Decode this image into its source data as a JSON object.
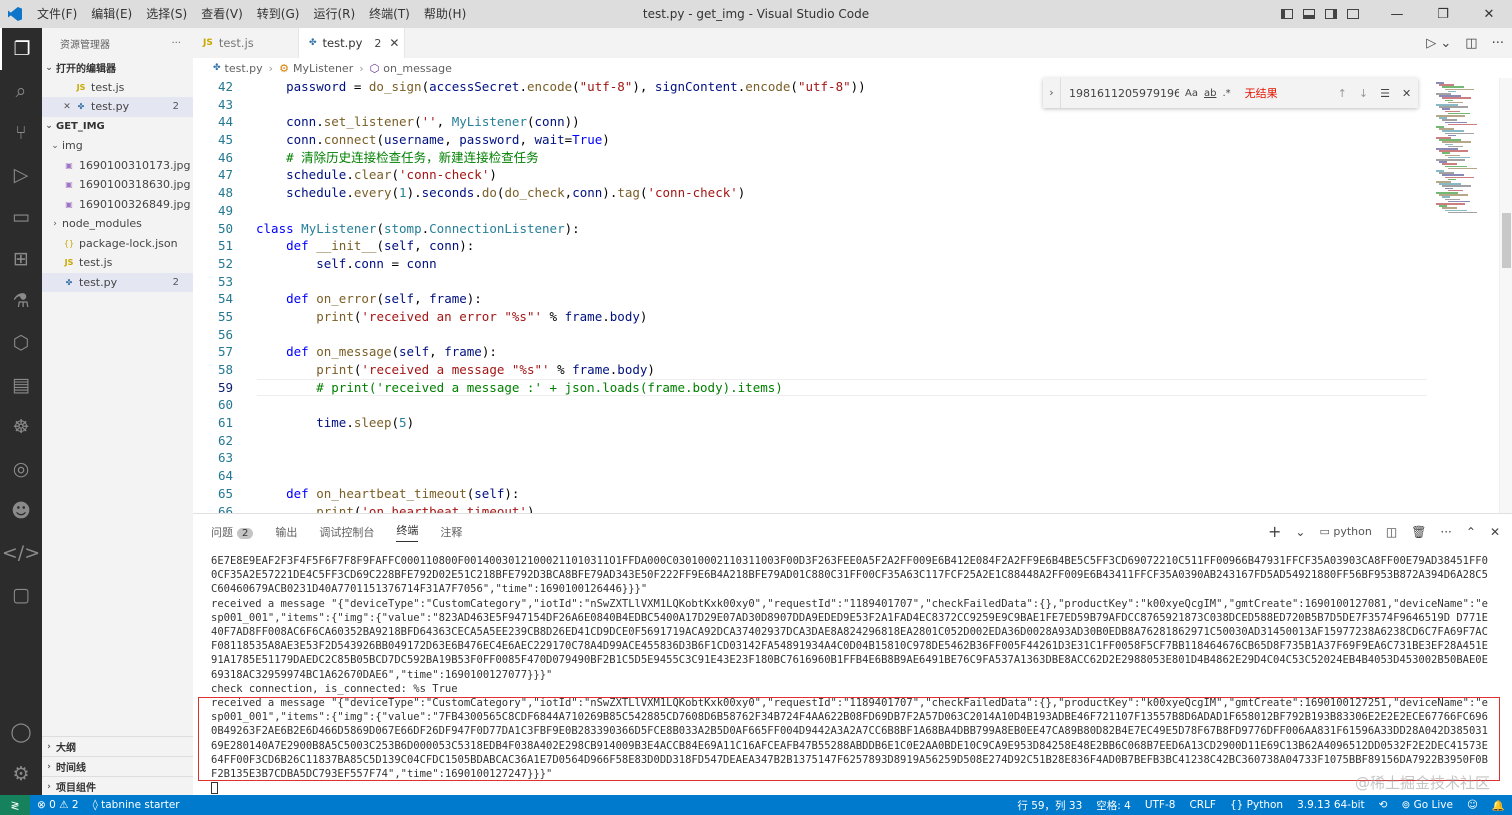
{
  "window": {
    "title": "test.py - get_img - Visual Studio Code",
    "menu": [
      "文件(F)",
      "编辑(E)",
      "选择(S)",
      "查看(V)",
      "转到(G)",
      "运行(R)",
      "终端(T)",
      "帮助(H)"
    ],
    "controls": {
      "minimize": "—",
      "restore": "❐",
      "close": "✕"
    }
  },
  "activity_bar": {
    "icons": [
      "explorer-icon",
      "search-icon",
      "source-control-icon",
      "run-debug-icon",
      "remote-explorer-icon",
      "extensions-icon",
      "testing-icon",
      "three-d-icon",
      "docker-icon",
      "octopus-icon",
      "network-icon",
      "alien-icon",
      "code-icon",
      "chat-icon"
    ],
    "bottom_icons": [
      "account-icon",
      "settings-gear-icon"
    ]
  },
  "sidebar": {
    "title": "资源管理器",
    "more": "···",
    "open_editors": {
      "header": "打开的编辑器",
      "items": [
        {
          "icon": "JS",
          "name": "test.js",
          "badge": ""
        },
        {
          "icon": "py",
          "name": "test.py",
          "badge": "2"
        }
      ]
    },
    "folder": {
      "header": "GET_IMG",
      "items": [
        {
          "type": "folder",
          "name": "img",
          "expanded": true,
          "badge": ""
        },
        {
          "type": "image",
          "name": "1690100310173.jpg",
          "badge": ""
        },
        {
          "type": "image",
          "name": "1690100318630.jpg",
          "badge": ""
        },
        {
          "type": "image",
          "name": "1690100326849.jpg",
          "badge": ""
        },
        {
          "type": "folder",
          "name": "node_modules",
          "expanded": false,
          "badge": ""
        },
        {
          "type": "json",
          "name": "package-lock.json",
          "badge": ""
        },
        {
          "type": "js",
          "name": "test.js",
          "badge": ""
        },
        {
          "type": "py",
          "name": "test.py",
          "badge": "2"
        }
      ]
    },
    "bottom_sections": [
      "大纲",
      "时间线",
      "项目组件"
    ]
  },
  "tabs": [
    {
      "icon": "JS",
      "label": "test.js",
      "badge": "",
      "active": false
    },
    {
      "icon": "py",
      "label": "test.py",
      "badge": "2",
      "active": true
    }
  ],
  "breadcrumb": {
    "file": "test.py",
    "class": "MyListener",
    "method": "on_message"
  },
  "find_widget": {
    "input": "1981611205979196.i",
    "match_case": "Aa",
    "whole_word": "ab",
    "regex": ".*",
    "result": "无结果"
  },
  "code_lines": [
    {
      "n": "42",
      "html": "    <span class=\"p\">password</span> = <span class=\"f\">do_sign</span>(<span class=\"p\">accessSecret</span>.<span class=\"f\">encode</span>(<span class=\"s\">\"utf-8\"</span>), <span class=\"p\">signContent</span>.<span class=\"f\">encode</span>(<span class=\"s\">\"utf-8\"</span>))"
    },
    {
      "n": "43",
      "html": ""
    },
    {
      "n": "44",
      "html": "    <span class=\"p\">conn</span>.<span class=\"f\">set_listener</span>(<span class=\"s\">''</span>, <span class=\"cl\">MyListener</span>(<span class=\"p\">conn</span>))"
    },
    {
      "n": "45",
      "html": "    <span class=\"p\">conn</span>.<span class=\"f\">connect</span>(<span class=\"p\">username</span>, <span class=\"p\">password</span>, <span class=\"p\">wait</span>=<span class=\"k\">True</span>)"
    },
    {
      "n": "46",
      "html": "    <span class=\"c\"># 清除历史连接检查任务，新建连接检查任务</span>"
    },
    {
      "n": "47",
      "html": "    <span class=\"p\">schedule</span>.<span class=\"f\">clear</span>(<span class=\"s\">'conn-check'</span>)"
    },
    {
      "n": "48",
      "html": "    <span class=\"p\">schedule</span>.<span class=\"f\">every</span>(<span class=\"cl\">1</span>).<span class=\"p\">seconds</span>.<span class=\"f\">do</span>(<span class=\"f\">do_check</span>,<span class=\"p\">conn</span>).<span class=\"f\">tag</span>(<span class=\"s\">'conn-check'</span>)"
    },
    {
      "n": "49",
      "html": ""
    },
    {
      "n": "50",
      "html": "<span class=\"k\">class</span> <span class=\"cl\">MyListener</span>(<span class=\"cl\">stomp</span>.<span class=\"cl\">ConnectionListener</span>):"
    },
    {
      "n": "51",
      "html": "    <span class=\"k\">def</span> <span class=\"f\">__init__</span>(<span class=\"p\">self</span>, <span class=\"p\">conn</span>):"
    },
    {
      "n": "52",
      "html": "        <span class=\"p\">self</span>.<span class=\"p\">conn</span> = <span class=\"p\">conn</span>"
    },
    {
      "n": "53",
      "html": ""
    },
    {
      "n": "54",
      "html": "    <span class=\"k\">def</span> <span class=\"f\">on_error</span>(<span class=\"p\">self</span>, <span class=\"p\">frame</span>):"
    },
    {
      "n": "55",
      "html": "        <span class=\"f\">print</span>(<span class=\"s\">'received an error \"%s\"'</span> % <span class=\"p\">frame</span>.<span class=\"p\">body</span>)"
    },
    {
      "n": "56",
      "html": ""
    },
    {
      "n": "57",
      "html": "    <span class=\"k\">def</span> <span class=\"f\">on_message</span>(<span class=\"p\">self</span>, <span class=\"p\">frame</span>):"
    },
    {
      "n": "58",
      "html": "        <span class=\"f\">print</span>(<span class=\"s\">'received a message \"%s\"'</span> % <span class=\"p\">frame</span>.<span class=\"p\">body</span>)"
    },
    {
      "n": "59",
      "html": "        <span class=\"c\"># print('received a message :' + json.loads(frame.body).items)</span>",
      "current": true
    },
    {
      "n": "60",
      "html": ""
    },
    {
      "n": "61",
      "html": "        <span class=\"p\">time</span>.<span class=\"f\">sleep</span>(<span class=\"cl\">5</span>)"
    },
    {
      "n": "62",
      "html": ""
    },
    {
      "n": "63",
      "html": ""
    },
    {
      "n": "64",
      "html": ""
    },
    {
      "n": "65",
      "html": "    <span class=\"k\">def</span> <span class=\"f\">on_heartbeat_timeout</span>(<span class=\"p\">self</span>):"
    },
    {
      "n": "66",
      "html": "        <span class=\"f\">print</span>(<span class=\"s\">'on_heartbeat_timeout'</span>)"
    }
  ],
  "panel": {
    "tabs": [
      {
        "label": "问题",
        "badge": "2",
        "active": false
      },
      {
        "label": "输出",
        "badge": "",
        "active": false
      },
      {
        "label": "调试控制台",
        "badge": "",
        "active": false
      },
      {
        "label": "终端",
        "badge": "",
        "active": true
      },
      {
        "label": "注释",
        "badge": "",
        "active": false
      }
    ],
    "terminal_name": "python",
    "actions": {
      "add": "+",
      "add_menu": "⌄",
      "split": "◫",
      "kill": "🗑",
      "more": "···",
      "maximize": "⌃",
      "close": "✕"
    },
    "terminal_lines": [
      "6E7E8E9EAF2F3F4F5F6F7F8F9FAFFC000110800F00140030121000211010311O1FFDA000C03010002110311003F00D3F263FEE0A5F2A2FF009E6B412E084F2A2FF9E6B4BE5C5FF3CD69072210C511FF00966B47931FFCF35A03903CA8FF00E79AD38451FF00CF35A2E57221DE4C5FF3CD69C228BFE792D02E51C218BFE792D3BCA8BFE79AD343E50F222FF9E6B4A218BFE79AD01C880C31FF00CF35A63C117FCF25A2E1C88448A2FF009E6B43411FFCF35A0390AB243167FD5AD54921880FF56BF953B872A394D6A28C5C60460679ACB0231D40A7701151376714F31A7F7056\",\"time\":1690100126446}}}\"",
      "received a message \"{\"deviceType\":\"CustomCategory\",\"iotId\":\"nSwZXTLlVXM1LQKobtKxk00xy0\",\"requestId\":\"1189401707\",\"checkFailedData\":{},\"productKey\":\"k00xyeQcgIM\",\"gmtCreate\":1690100127081,\"deviceName\":\"esp001_001\",\"items\":{\"img\":{\"value\":\"823AD463E5F947154DF26A6E0840B4EDBC5400A17D29E07AD30D8907DDA9EDED9E53F2A1FAD4EC8372CC9259E9C9BAE1FE7ED59B79AFDCC8765921873C038DCED588ED720B5B7D5DE7F3574F9646519D D771E40F7AD8FF008AC6F6CA60352BA9218BFD64363CECA5A5EE239CB8D26ED41CD9DCE0F5691719ACA92DCA37402937DCA3DAE8A824296818EA2801C052D002EDA36D0028A93AD30B0EDB8A76281862971C50030AD31450013AF15977238A6238CD6C7FA69F7ACF08118535A8AE3E53F2D543926BB049172D63E6B476EC4E6AEC229170C78A4D99ACE455836D3B6F1CD03142FA54891934A4C0D04B15810C978DE5462B36FF005F44261D3E31C1FF0058F5CF7BB118464676CB65D8F735B1A37F69F9EA6C731BE3EF28A451E91A1785E51179DAEDC2C85B05BCD7DC592BA19B53F0FF0085F470D079490BF2B1C5D5E9455C3C91E43E23F180BC7616960B1FFB4E6B8B9AE6491BE76C9FA537A1363DBE8ACC62D2E2988053E801D4B4862E29D4C04C53C52024EB4B4053D453002B50BAE0E69318AC32959974BC1A62670DAE6\",\"time\":1690100127077}}}\"",
      "check connection, is_connected: %s True",
      "received a message \"{\"deviceType\":\"CustomCategory\",\"iotId\":\"nSwZXTLlVXM1LQKobtKxk00xy0\",\"requestId\":\"1189401707\",\"checkFailedData\":{},\"productKey\":\"k00xyeQcgIM\",\"gmtCreate\":1690100127251,\"deviceName\":\"esp001_001\",\"items\":{\"img\":{\"value\":\"7FB4300565C8CDF6844A710269B85C542885CD7608D6B58762F34B724F4AA622B08FD69DB7F2A57D063C2014A10D4B193ADBE46F721107F13557B8D6ADAD1F658012BF792B193B83306E2E2E2ECE67766FC6960B49263F2AE6B2E6D466D5869D067E66DF26DF947F0D77DA1C3FBF9E0B283390366D5FCE8B033A2B5D0AF665FF004D9442A3A2A7CC6B8BF1A68BA4DBB799A8EB0EE47CA89B80D82B4E7EC49E5D78F67B8FD9776DFF006AA831F61596A33DD28A042D38503169E280140A7E2900B8A5C5003C253B6D000053C5318EDB4F038A402E298CB914009B3E4ACCB84E69A11C16AFCEAFB47B55288ABDDB6E1C0E2AA0BDE10C9CA9E953D84258E48E2BB6C068B7EED6A13CD2900D11E69C13B62A4096512DD0532F2E2DEC41573E64FF00F3CD6B26C11837BA85C5D139C04CFDC1505BDABCAC36A1E7D0564D966F58E83D0DD318FD547DEAEA347B2B1375147F6257893D8919A56259D508E274D92C51B28E836F4AD0B7BEFB3BC41238C42BC360738A04733F1075BBF89156DA7922B3950F0BF2B135E3B7CDBA5DC793EF557F74\",\"time\":1690100127247}}}\""
    ]
  },
  "watermark": "@稀土掘金技术社区",
  "status_bar": {
    "remote": "≷",
    "errors": "⊗ 0 ⚠ 2",
    "extension": "tabnine starter",
    "position": "行 59，列 33",
    "indent": "空格: 4",
    "encoding": "UTF-8",
    "eol": "CRLF",
    "language": "Python",
    "interpreter": "3.9.13 64-bit",
    "live": "Go Live",
    "extra_icons": [
      "copilot-icon",
      "notifications-bell-icon"
    ]
  }
}
